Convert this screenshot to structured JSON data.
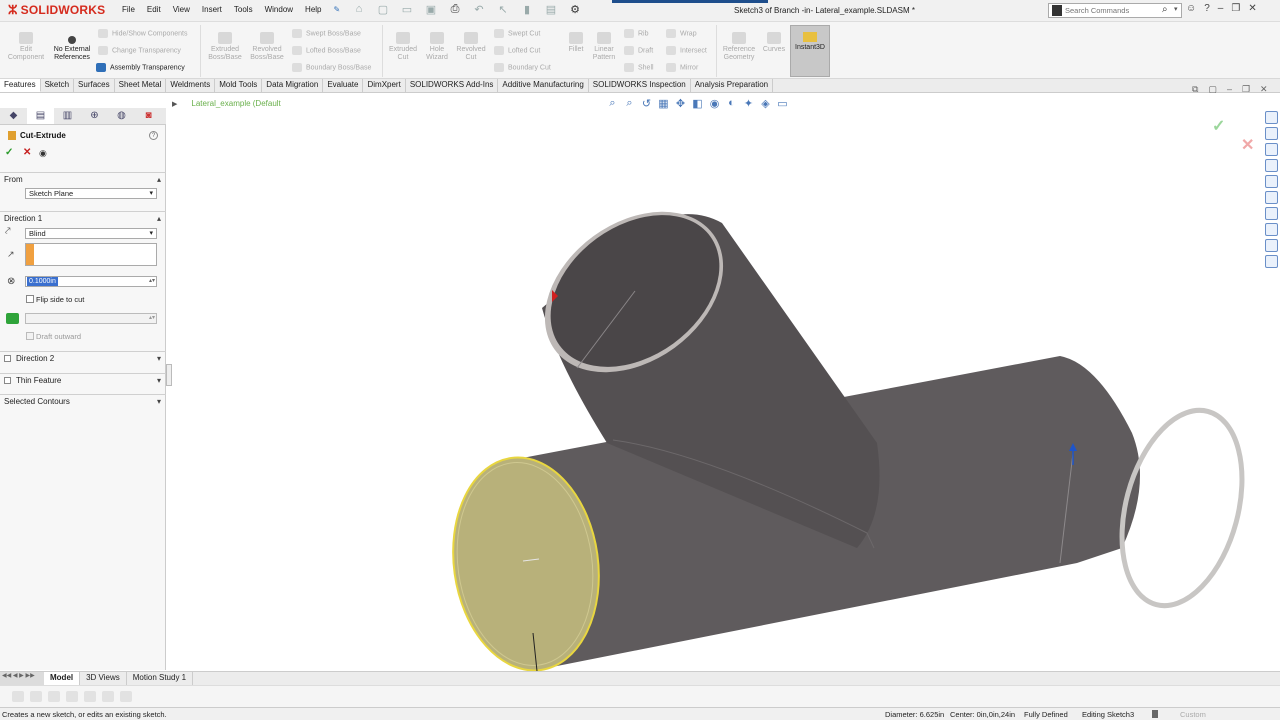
{
  "app": {
    "logo_text": "SOLIDWORKS",
    "doc_title": "Sketch3 of Branch -in- Lateral_example.SLDASM *"
  },
  "menu": [
    "File",
    "Edit",
    "View",
    "Insert",
    "Tools",
    "Window",
    "Help"
  ],
  "search": {
    "placeholder": "Search Commands"
  },
  "command_manager": {
    "edit_component": "Edit Component",
    "no_external_refs": "No External References",
    "hide_show": "Hide/Show Components",
    "change_transparency": "Change Transparency",
    "assembly_transparency": "Assembly Transparency",
    "extruded_boss": "Extruded Boss/Base",
    "revolved_boss": "Revolved Boss/Base",
    "swept_boss": "Swept Boss/Base",
    "lofted_boss": "Lofted Boss/Base",
    "boundary_boss": "Boundary Boss/Base",
    "extruded_cut": "Extruded Cut",
    "hole_wizard": "Hole Wizard",
    "revolved_cut": "Revolved Cut",
    "swept_cut": "Swept Cut",
    "lofted_cut": "Lofted Cut",
    "boundary_cut": "Boundary Cut",
    "fillet": "Fillet",
    "linear_pattern": "Linear Pattern",
    "rib": "Rib",
    "draft": "Draft",
    "shell": "Shell",
    "wrap": "Wrap",
    "intersect": "Intersect",
    "mirror": "Mirror",
    "reference_geometry": "Reference Geometry",
    "curves": "Curves",
    "instant3d": "Instant3D"
  },
  "tabs": [
    "Features",
    "Sketch",
    "Surfaces",
    "Sheet Metal",
    "Weldments",
    "Mold Tools",
    "Data Migration",
    "Evaluate",
    "DimXpert",
    "SOLIDWORKS Add-Ins",
    "Additive Manufacturing",
    "SOLIDWORKS Inspection",
    "Analysis Preparation"
  ],
  "property_manager": {
    "title": "Cut-Extrude",
    "from_label": "From",
    "from_value": "Sketch Plane",
    "direction1_label": "Direction 1",
    "end_condition": "Blind",
    "depth_value": "0.1000in",
    "flip_side_label": "Flip side to cut",
    "draft_outward_label": "Draft outward",
    "direction2_label": "Direction 2",
    "thin_feature_label": "Thin Feature",
    "selected_contours_label": "Selected Contours"
  },
  "graphics": {
    "tree_item": "Lateral_example (Default"
  },
  "bottom_tabs": [
    "Model",
    "3D Views",
    "Motion Study 1"
  ],
  "status": {
    "message": "Creates a new sketch, or edits an existing sketch.",
    "diameter": "Diameter: 6.625in",
    "center": "Center: 0in,0in,24in",
    "definition": "Fully Defined",
    "editing": "Editing Sketch3",
    "units": "Custom"
  },
  "colors": {
    "pipe_body": "#5e5a5c",
    "cut_face": "#b9b27a",
    "highlight": "#e8d640",
    "accent_blue": "#1e4e8c"
  }
}
